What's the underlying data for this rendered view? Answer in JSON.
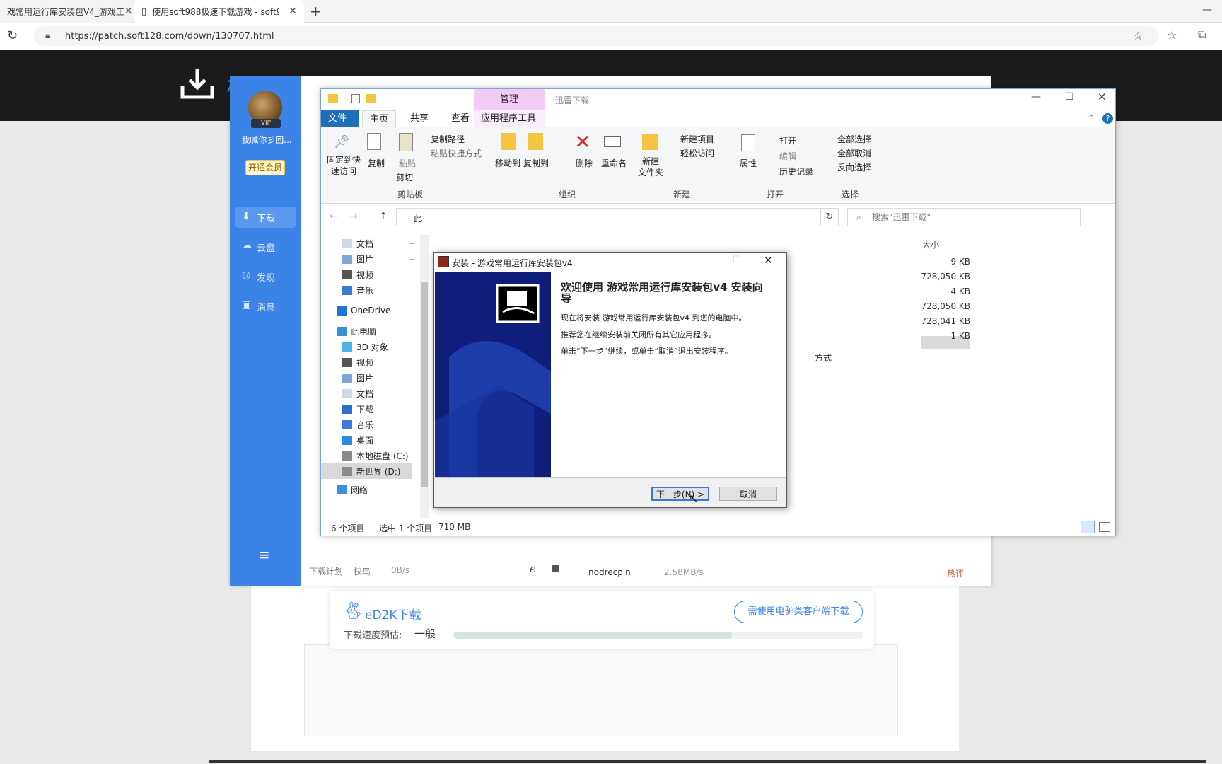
{
  "browser": {
    "tabs": [
      {
        "label": "戏常用运行库安装包V4_游戏工"
      },
      {
        "label": "使用soft988极速下载游戏 - soft9"
      }
    ],
    "url": "https://patch.soft128.com/down/130707.html"
  },
  "site": {
    "title": "极速下载"
  },
  "thunder": {
    "username": "我喊你彡回...",
    "vip_badge": "VIP",
    "open_member": "开通会员",
    "nav": [
      "下载",
      "云盘",
      "发现",
      "消息"
    ],
    "footer": {
      "plan": "下载计划",
      "fast": "快鸟",
      "speed": "0B/s"
    },
    "peer": {
      "name": "nodrecpin",
      "speed": "2.58MB/s",
      "hot": "热评"
    }
  },
  "explorer": {
    "manage_label": "管理",
    "title": "迅雷下载",
    "tabs": [
      "文件",
      "主页",
      "共享",
      "查看",
      "应用程序工具"
    ],
    "ribbon": {
      "pin": "固定到快\n速访问",
      "copy": "复制",
      "paste": "粘贴",
      "copy_path": "复制路径",
      "paste_shortcut": "粘贴快捷方式",
      "cut": "剪切",
      "group_clipboard": "剪贴板",
      "move_to": "移动到",
      "copy_to": "复制到",
      "delete": "删除",
      "rename": "重命名",
      "group_organize": "组织",
      "new_folder": "新建\n文件夹",
      "new_item": "新建项目",
      "easy_access": "轻松访问",
      "group_new": "新建",
      "properties": "属性",
      "open": "打开",
      "edit": "编辑",
      "history": "历史记录",
      "group_open": "打开",
      "select_all": "全部选择",
      "select_none": "全部取消",
      "invert": "反向选择",
      "group_select": "选择"
    },
    "address_partial": "此",
    "search_placeholder": "搜索\"迅雷下载\"",
    "nav_items": [
      {
        "label": "文档",
        "icon": "document-icon"
      },
      {
        "label": "图片",
        "icon": "picture-icon"
      },
      {
        "label": "视频",
        "icon": "video-icon"
      },
      {
        "label": "音乐",
        "icon": "music-icon"
      },
      {
        "label": "OneDrive",
        "icon": "onedrive-icon"
      },
      {
        "label": "此电脑",
        "icon": "pc-icon"
      },
      {
        "label": "3D 对象",
        "icon": "3d-icon"
      },
      {
        "label": "视频",
        "icon": "video-icon"
      },
      {
        "label": "图片",
        "icon": "picture-icon"
      },
      {
        "label": "文档",
        "icon": "document-icon"
      },
      {
        "label": "下载",
        "icon": "download-icon"
      },
      {
        "label": "音乐",
        "icon": "music-icon"
      },
      {
        "label": "桌面",
        "icon": "desktop-icon"
      },
      {
        "label": "本地磁盘 (C:)",
        "icon": "drive-icon"
      },
      {
        "label": "新世界 (D:)",
        "icon": "drive-icon"
      },
      {
        "label": "网络",
        "icon": "network-icon"
      }
    ],
    "col_size": "大小",
    "sizes": [
      "9 KB",
      "728,050 KB",
      "4 KB",
      "728,050 KB",
      "728,041 KB",
      "1 KB"
    ],
    "partial_type": "方式",
    "status": {
      "count": "6 个项目",
      "selected": "选中 1 个项目",
      "size": "710 MB"
    }
  },
  "installer": {
    "title": "安装 - 游戏常用运行库安装包v4",
    "heading": "欢迎使用 游戏常用运行库安装包v4 安装向导",
    "line1": "现在将安装 游戏常用运行库安装包v4 到您的电脑中。",
    "line2": "推荐您在继续安装前关闭所有其它应用程序。",
    "line3": "单击“下一步”继续，或单击“取消”退出安装程序。",
    "next": "下一步(N) >",
    "cancel": "取消"
  },
  "ed2k": {
    "title": "eD2K下载",
    "button": "需使用电驴类客户端下载",
    "speed_label": "下载速度预估:",
    "speed_value": "一般",
    "progress": 0.68
  },
  "colors": {
    "accent": "#3c83e8",
    "sitebar": "#1b1b1d",
    "title": "#3a8ee6"
  }
}
